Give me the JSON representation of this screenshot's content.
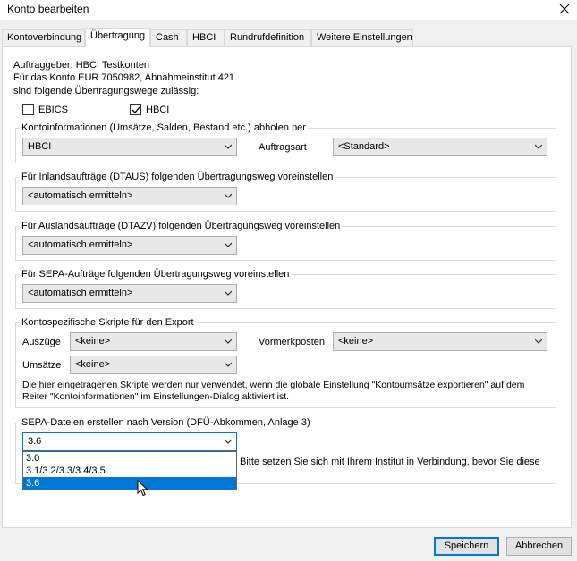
{
  "window": {
    "title": "Konto bearbeiten"
  },
  "tabs": [
    "Kontoverbindung",
    "Übertragung",
    "Cash",
    "HBCI",
    "Rundrufdefinition",
    "Weitere Einstellungen"
  ],
  "active_tab": "Übertragung",
  "info": {
    "line1": "Auftraggeber: HBCI Testkonten",
    "line2": "Für das Konto EUR 7050982, Abnahmeinstitut 421",
    "line3": "sind folgende Übertragungswege zulässig:"
  },
  "transfer_ways": {
    "ebics": {
      "label": "EBICS",
      "checked": false
    },
    "hbci": {
      "label": "HBCI",
      "checked": true
    }
  },
  "kontoinfo": {
    "group_label": "Kontoinformationen (Umsätze, Salden, Bestand etc.) abholen per",
    "method_value": "HBCI",
    "auftragsart_label": "Auftragsart",
    "auftragsart_value": "<Standard>"
  },
  "inland": {
    "group_label": "Für Inlandsaufträge (DTAUS) folgenden Übertragungsweg voreinstellen",
    "value": "<automatisch ermitteln>"
  },
  "ausland": {
    "group_label": "Für Auslandsaufträge (DTAZV) folgenden Übertragungsweg voreinstellen",
    "value": "<automatisch ermitteln>"
  },
  "sepa": {
    "group_label": "Für SEPA-Aufträge folgenden Übertragungsweg voreinstellen",
    "value": "<automatisch ermitteln>"
  },
  "scripts": {
    "group_label": "Kontospezifische Skripte für den Export",
    "auszuege_label": "Auszüge",
    "auszuege_value": "<keine>",
    "vormerk_label": "Vormerkposten",
    "vormerk_value": "<keine>",
    "umsaetze_label": "Umsätze",
    "umsaetze_value": "<keine>",
    "note_line1": "Die hier eingetragenen Skripte werden nur verwendet, wenn die globale Einstellung \"Kontoumsätze exportieren\" auf dem",
    "note_line2": "Reiter \"Kontoinformationen\" im Einstellungen-Dialog aktiviert ist."
  },
  "sepa_version": {
    "group_label": "SEPA-Dateien erstellen nach Version (DFÜ-Abkommen, Anlage 3)",
    "value": "3.6",
    "options": [
      "3.0",
      "3.1/3.2/3.3/3.4/3.5",
      "3.6"
    ],
    "selected_index": 2,
    "hint": "Bitte setzen Sie sich mit Ihrem Institut in Verbindung, bevor Sie diese"
  },
  "buttons": {
    "save": "Speichern",
    "cancel": "Abbrechen"
  },
  "colors": {
    "accent": "#0078d7",
    "panel": "#ffffff",
    "dialog": "#f0f0f0"
  },
  "icons": [
    "close-icon",
    "chevron-down-icon",
    "checkmark-icon",
    "mouse-pointer-icon"
  ]
}
